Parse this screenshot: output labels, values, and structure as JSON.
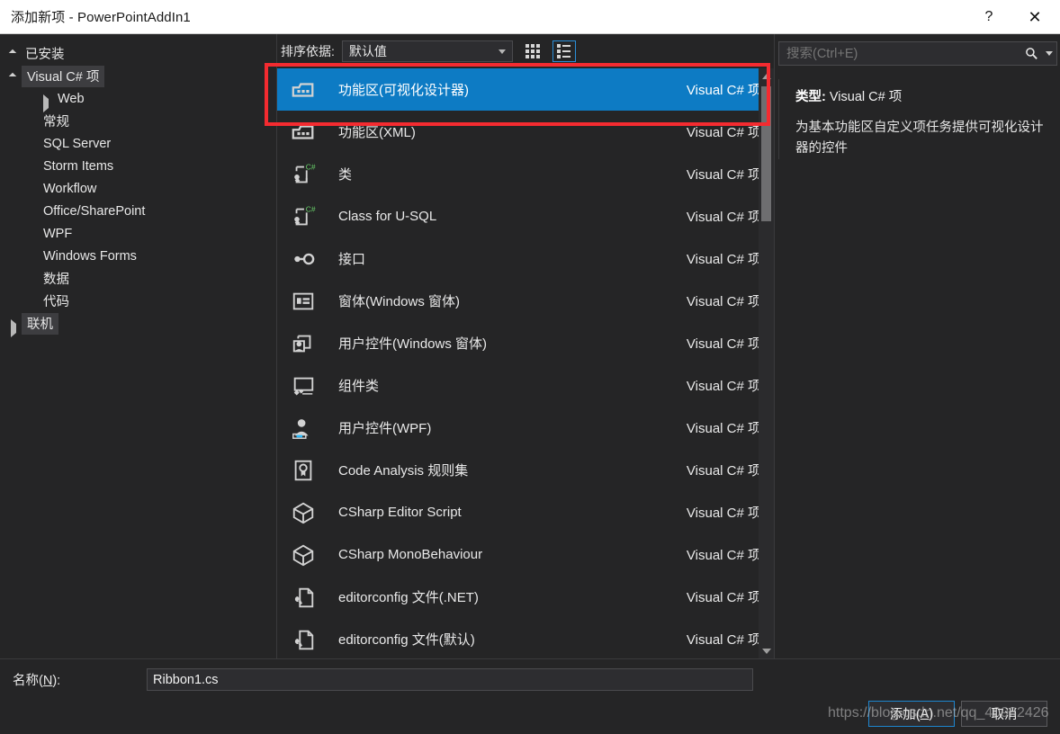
{
  "window": {
    "title": "添加新项 - PowerPointAddIn1",
    "help_label": "?",
    "close_label": "✕"
  },
  "sidebar": {
    "header": "已安装",
    "nodes": [
      {
        "label": "Visual C# 项",
        "level": 0,
        "state": "expanded",
        "selected": true
      },
      {
        "label": "Web",
        "level": 1,
        "state": "collapsed",
        "selected": false
      },
      {
        "label": "常规",
        "level": 1,
        "state": "leaf",
        "selected": false
      },
      {
        "label": "SQL Server",
        "level": 1,
        "state": "leaf",
        "selected": false
      },
      {
        "label": "Storm Items",
        "level": 1,
        "state": "leaf",
        "selected": false
      },
      {
        "label": "Workflow",
        "level": 1,
        "state": "leaf",
        "selected": false
      },
      {
        "label": "Office/SharePoint",
        "level": 1,
        "state": "leaf",
        "selected": false
      },
      {
        "label": "WPF",
        "level": 1,
        "state": "leaf",
        "selected": false
      },
      {
        "label": "Windows Forms",
        "level": 1,
        "state": "leaf",
        "selected": false
      },
      {
        "label": "数据",
        "level": 1,
        "state": "leaf",
        "selected": false
      },
      {
        "label": "代码",
        "level": 1,
        "state": "leaf",
        "selected": false
      },
      {
        "label": "联机",
        "level": 0,
        "state": "collapsed",
        "selected": false
      }
    ]
  },
  "toolbar": {
    "sort_label": "排序依据:",
    "sort_value": "默认值",
    "grid_view_name": "grid-view",
    "list_view_name": "list-view",
    "active_view": "list"
  },
  "search": {
    "placeholder": "搜索(Ctrl+E)",
    "value": ""
  },
  "items": [
    {
      "title": "功能区(可视化设计器)",
      "kind": "Visual C# 项",
      "icon": "ribbon-icon",
      "selected": true
    },
    {
      "title": "功能区(XML)",
      "kind": "Visual C# 项",
      "icon": "ribbon-icon",
      "selected": false
    },
    {
      "title": "类",
      "kind": "Visual C# 项",
      "icon": "class-csharp-icon",
      "selected": false
    },
    {
      "title": "Class for U-SQL",
      "kind": "Visual C# 项",
      "icon": "class-csharp-icon",
      "selected": false
    },
    {
      "title": "接口",
      "kind": "Visual C# 项",
      "icon": "interface-icon",
      "selected": false
    },
    {
      "title": "窗体(Windows 窗体)",
      "kind": "Visual C# 项",
      "icon": "form-icon",
      "selected": false
    },
    {
      "title": "用户控件(Windows 窗体)",
      "kind": "Visual C# 项",
      "icon": "user-control-icon",
      "selected": false
    },
    {
      "title": "组件类",
      "kind": "Visual C# 项",
      "icon": "component-class-icon",
      "selected": false
    },
    {
      "title": "用户控件(WPF)",
      "kind": "Visual C# 项",
      "icon": "user-control-wpf-icon",
      "selected": false
    },
    {
      "title": "Code Analysis 规则集",
      "kind": "Visual C# 项",
      "icon": "ruleset-icon",
      "selected": false
    },
    {
      "title": "CSharp Editor Script",
      "kind": "Visual C# 项",
      "icon": "cube-icon",
      "selected": false
    },
    {
      "title": "CSharp MonoBehaviour",
      "kind": "Visual C# 项",
      "icon": "cube-icon",
      "selected": false
    },
    {
      "title": "editorconfig 文件(.NET)",
      "kind": "Visual C# 项",
      "icon": "config-file-icon",
      "selected": false
    },
    {
      "title": "editorconfig 文件(默认)",
      "kind": "Visual C# 项",
      "icon": "config-file-icon",
      "selected": false
    }
  ],
  "details": {
    "type_label": "类型:",
    "type_value": "Visual C# 项",
    "description": "为基本功能区自定义项任务提供可视化设计器的控件"
  },
  "bottom": {
    "name_label_prefix": "名称(",
    "name_label_key": "N",
    "name_label_suffix": "):",
    "name_value": "Ribbon1.cs",
    "add_prefix": "添加(",
    "add_key": "A",
    "add_suffix": ")",
    "cancel_label": "取消"
  },
  "watermark": {
    "text": "https://blog.csdn.net/qq_40982426"
  },
  "colors": {
    "selection_blue": "#0d7bc4",
    "annotation_red": "#f42b30",
    "window_bg": "#252526",
    "titlebar_bg": "#ffffff"
  }
}
